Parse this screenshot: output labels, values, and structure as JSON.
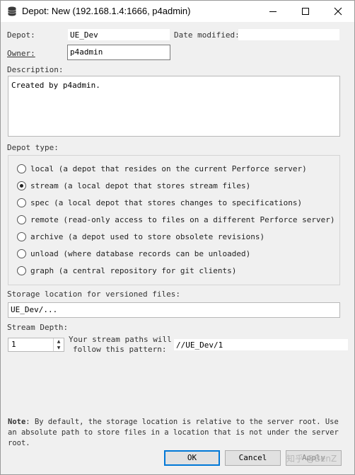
{
  "window": {
    "title": "Depot: New (192.168.1.4:1666,  p4admin)",
    "controls": [
      "minimize",
      "maximize",
      "close"
    ]
  },
  "form": {
    "depot_label": "Depot:",
    "depot_value": "UE_Dev",
    "date_modified_label": "Date modified:",
    "date_modified_value": "",
    "owner_label": "Owner:",
    "owner_value": "p4admin",
    "description_label": "Description:",
    "description_value": "Created by p4admin."
  },
  "depot_type": {
    "label": "Depot type:",
    "selected": "stream",
    "options": [
      {
        "key": "local",
        "label": "local (a depot that resides on the current Perforce server)"
      },
      {
        "key": "stream",
        "label": "stream (a local depot that stores stream files)"
      },
      {
        "key": "spec",
        "label": "spec (a local depot that stores changes to specifications)"
      },
      {
        "key": "remote",
        "label": "remote (read-only access to files on a different Perforce server)"
      },
      {
        "key": "archive",
        "label": "archive (a depot used to store obsolete revisions)"
      },
      {
        "key": "unload",
        "label": "unload (where database records can be unloaded)"
      },
      {
        "key": "graph",
        "label": "graph (a central repository for git clients)"
      }
    ]
  },
  "storage": {
    "label": "Storage location for versioned files:",
    "value": "UE_Dev/..."
  },
  "stream_depth": {
    "label": "Stream Depth:",
    "value": "1",
    "pattern_line1": "Your stream paths will",
    "pattern_line2": "follow this pattern:",
    "pattern_value": "//UE_Dev/1"
  },
  "note": {
    "bold": "Note",
    "text": ": By default, the storage location is relative to the server root. Use an absolute path to store files in a location that is not under the server root."
  },
  "buttons": {
    "ok": "OK",
    "cancel": "Cancel",
    "apply": "Apply"
  },
  "watermark": "知乎 @BenZ"
}
